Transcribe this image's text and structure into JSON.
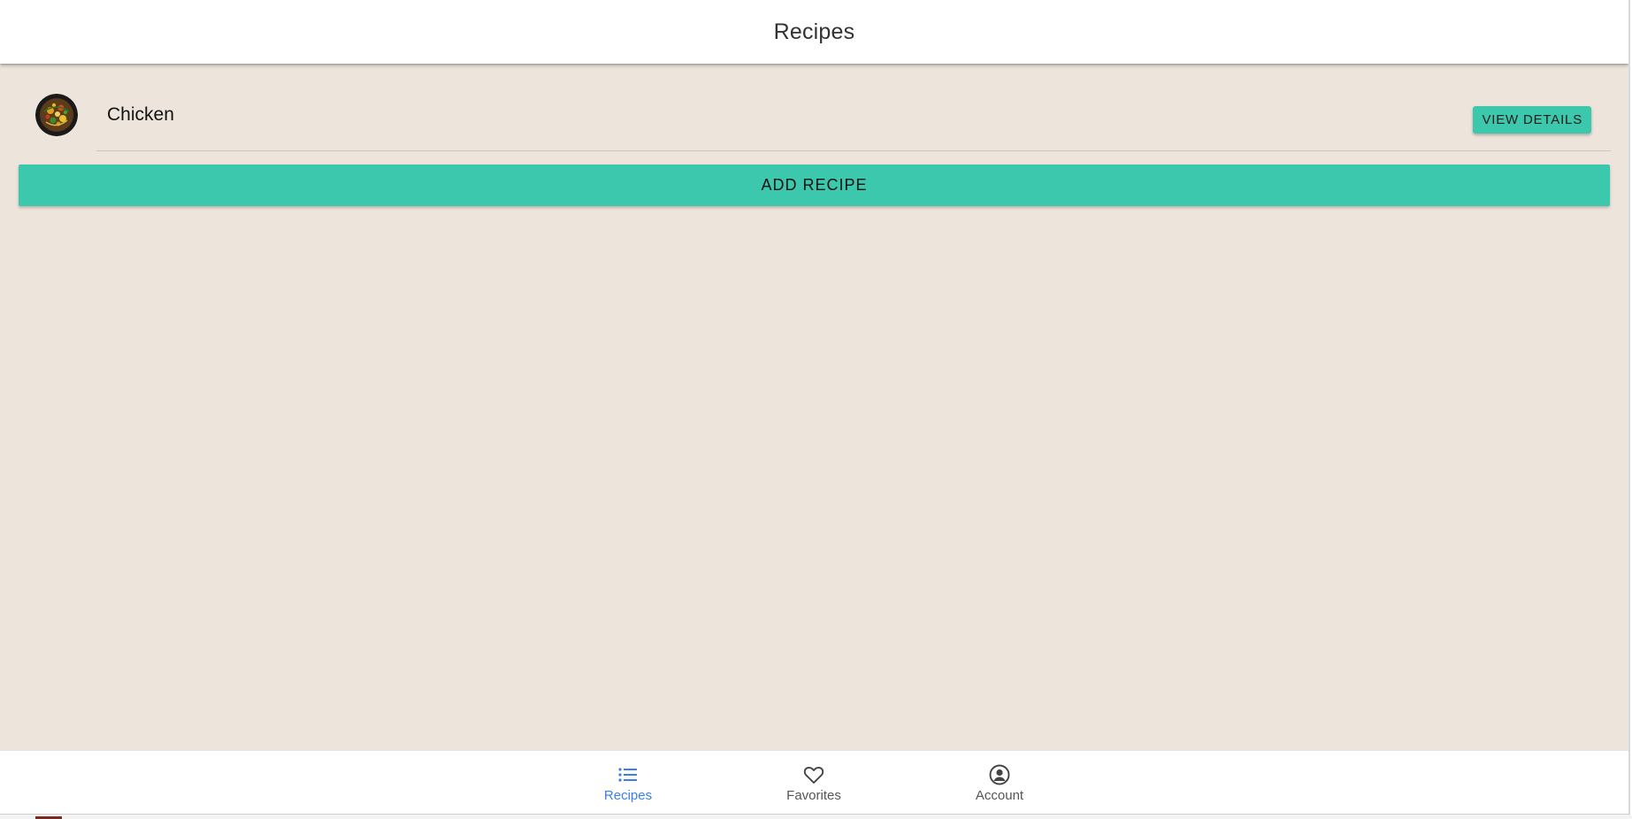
{
  "header": {
    "title": "Recipes"
  },
  "recipes": [
    {
      "name": "Chicken",
      "thumbnail_icon": "food-thumbnail",
      "view_label": "VIEW DETAILS"
    }
  ],
  "actions": {
    "add_recipe_label": "ADD RECIPE"
  },
  "tabs": [
    {
      "label": "Recipes",
      "icon": "list-icon",
      "active": true
    },
    {
      "label": "Favorites",
      "icon": "heart-icon",
      "active": false
    },
    {
      "label": "Account",
      "icon": "account-circle-icon",
      "active": false
    }
  ],
  "colors": {
    "background": "#ede4dc",
    "accent": "#3cc8ad",
    "active_tab": "#3b80e8",
    "toolbar": "#ffffff"
  }
}
